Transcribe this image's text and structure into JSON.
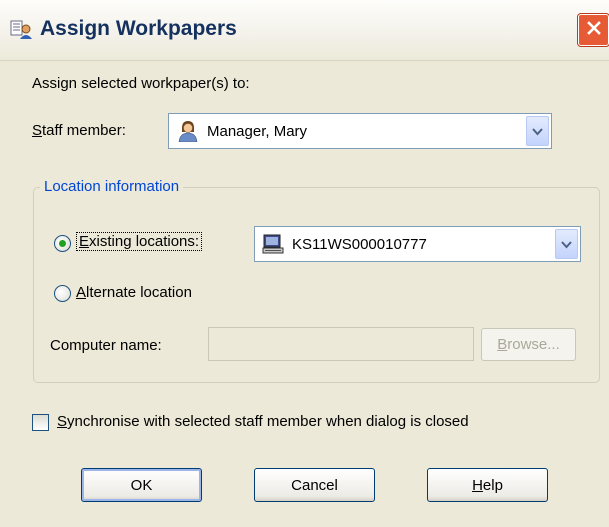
{
  "window": {
    "title": "Assign Workpapers"
  },
  "intro_text": "Assign selected workpaper(s) to:",
  "staff": {
    "label_accel": "S",
    "label_rest": "taff member:",
    "selected": "Manager, Mary"
  },
  "location_group": {
    "legend": "Location information",
    "existing_accel": "E",
    "existing_rest": "xisting locations:",
    "existing_selected": true,
    "existing_value": "KS11WS000010777",
    "alternate_accel": "A",
    "alternate_rest": "lternate location",
    "computer_label": "Computer name:",
    "computer_value": "",
    "browse_accel": "B",
    "browse_rest": "rowse..."
  },
  "sync": {
    "checked": false,
    "label_accel": "S",
    "label_rest": "ynchronise with selected staff member when dialog is closed"
  },
  "buttons": {
    "ok": "OK",
    "cancel": "Cancel",
    "help_accel": "H",
    "help_rest": "elp"
  },
  "colors": {
    "legend": "#0046d5",
    "close": "#e65b36",
    "radio_dot": "#21a121"
  }
}
